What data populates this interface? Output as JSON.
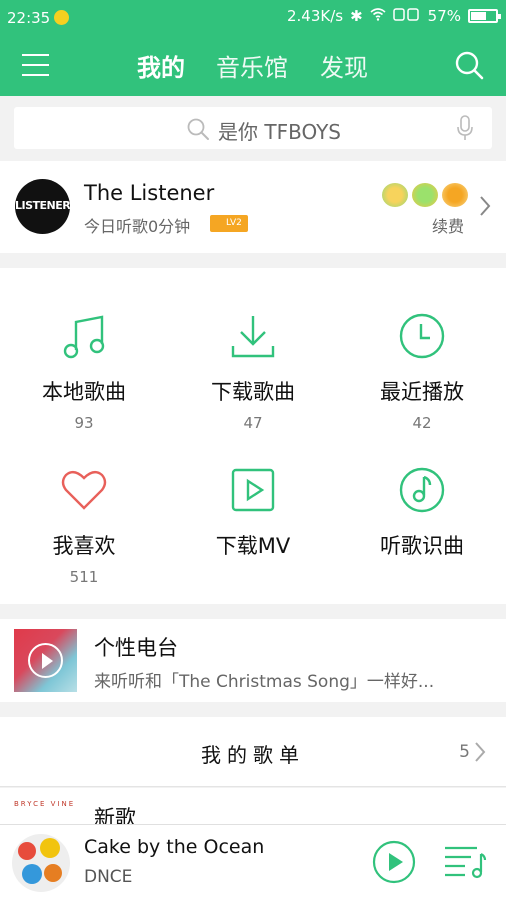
{
  "status_bar": {
    "time": "22:35",
    "speed": "2.43K/s",
    "battery": "57%"
  },
  "header": {
    "tabs": [
      {
        "label": "我的",
        "active": true
      },
      {
        "label": "音乐馆",
        "active": false
      },
      {
        "label": "发现",
        "active": false
      }
    ]
  },
  "search": {
    "placeholder": "是你 TFBOYS"
  },
  "profile": {
    "avatar_text": "LISTENER",
    "name": "The Listener",
    "listen_today": "今日听歌0分钟",
    "level_badge": "LV2",
    "renew": "续费"
  },
  "shortcuts": [
    {
      "label": "本地歌曲",
      "count": "93",
      "icon": "music-note-icon"
    },
    {
      "label": "下载歌曲",
      "count": "47",
      "icon": "download-icon"
    },
    {
      "label": "最近播放",
      "count": "42",
      "icon": "clock-icon"
    },
    {
      "label": "我喜欢",
      "count": "511",
      "icon": "heart-icon"
    },
    {
      "label": "下载MV",
      "count": "",
      "icon": "video-play-icon"
    },
    {
      "label": "听歌识曲",
      "count": "",
      "icon": "music-recognize-icon"
    }
  ],
  "radio": {
    "title": "个性电台",
    "description": "来听听和「The Christmas Song」一样好..."
  },
  "playlists": {
    "title": "我的歌单",
    "count": "5",
    "items": [
      {
        "label": "新歌",
        "cover_text": "BRYCE VINE"
      }
    ]
  },
  "player": {
    "song": "Cake by the Ocean",
    "artist": "DNCE"
  },
  "colors": {
    "accent": "#31c27c",
    "heart": "#e8605a"
  }
}
